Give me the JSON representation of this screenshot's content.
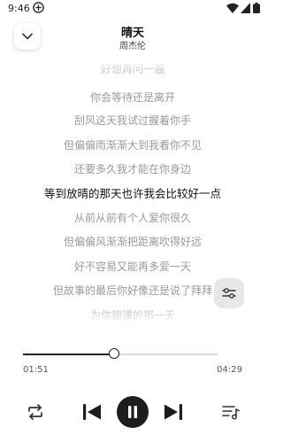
{
  "status_bar": {
    "time": "9:46"
  },
  "header": {
    "title": "晴天",
    "artist": "周杰伦"
  },
  "lyrics": {
    "lines": [
      "好想再问一遍",
      "你会等待还是离开",
      "刮风这天我试过握着你手",
      "但偏偏雨渐渐大到我看你不见",
      "还要多久我才能在你身边",
      "等到放晴的那天也许我会比较好一点",
      "从前从前有个人爱你很久",
      "但偏偏风渐渐把距离吹得好远",
      "好不容易又能再多爱一天",
      "但故事的最后你好像还是说了拜拜",
      "为你翘课的那一天"
    ],
    "active_index": 5
  },
  "player": {
    "elapsed": "01:51",
    "total": "04:29",
    "progress": 0.47
  },
  "icons": {
    "collapse": "chevron-down-icon",
    "equalizer": "sliders-icon",
    "repeat": "repeat-icon",
    "previous": "skip-previous-icon",
    "pause": "pause-icon",
    "next": "skip-next-icon",
    "playlist": "playlist-icon"
  },
  "colors": {
    "accent": "#1d1d1d",
    "inactive_lyric": "#9a9a9a",
    "active_lyric": "#111111"
  }
}
